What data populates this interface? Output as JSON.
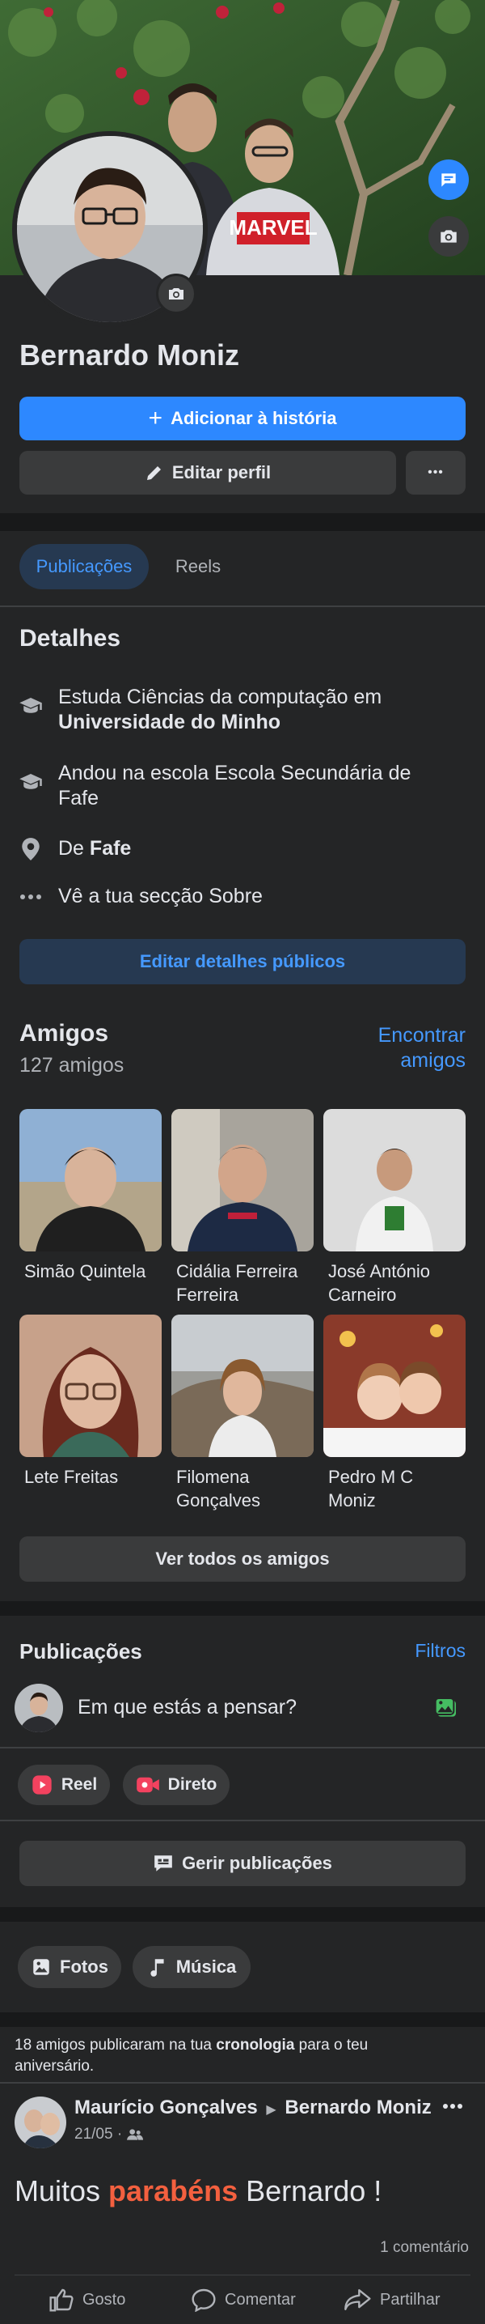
{
  "profile": {
    "name": "Bernardo Moniz",
    "cover_shirt_text": "MARVEL",
    "add_story_label": "Adicionar à história",
    "edit_profile_label": "Editar perfil",
    "more_label": "•••"
  },
  "tabs": [
    {
      "label": "Publicações",
      "active": true
    },
    {
      "label": "Reels",
      "active": false
    }
  ],
  "details": {
    "title": "Detalhes",
    "study_prefix": "Estuda Ciências da computação em",
    "study_place": "Universidade do Minho",
    "school_line1": "Andou na escola Escola Secundária de",
    "school_line2": "Fafe",
    "from_prefix": "De",
    "from_place": "Fafe",
    "about": "Vê a tua secção Sobre",
    "edit_public_label": "Editar detalhes públicos"
  },
  "friends": {
    "title": "Amigos",
    "count": "127 amigos",
    "find_line1": "Encontrar",
    "find_line2": "amigos",
    "list": [
      {
        "line1": "Simão Quintela",
        "line2": ""
      },
      {
        "line1": "Cidália Ferreira",
        "line2": "Ferreira"
      },
      {
        "line1": "José António",
        "line2": "Carneiro"
      },
      {
        "line1": "Lete Freitas",
        "line2": ""
      },
      {
        "line1": "Filomena",
        "line2": "Gonçalves"
      },
      {
        "line1": "Pedro M C",
        "line2": "Moniz"
      }
    ],
    "see_all_label": "Ver todos os amigos"
  },
  "posts": {
    "title": "Publicações",
    "filters_label": "Filtros",
    "composer_placeholder": "Em que estás a pensar?",
    "reel_label": "Reel",
    "live_label": "Direto",
    "manage_label": "Gerir publicações"
  },
  "media_chips": [
    {
      "label": "Fotos",
      "icon": "photos-icon"
    },
    {
      "label": "Música",
      "icon": "music-note-icon"
    }
  ],
  "birthday_notice": {
    "prefix": "18 amigos publicaram na tua",
    "bold": "cronologia",
    "suffix": "para o teu",
    "line2": "aniversário."
  },
  "post": {
    "author": "Maurício Gonçalves",
    "arrow": "▶",
    "target": "Bernardo Moniz",
    "date": "21/05 ·",
    "text_before": "Muitos",
    "text_highlight": "parabéns",
    "text_after": "Bernardo !",
    "comments": "1 comentário",
    "like_label": "Gosto",
    "comment_label": "Comentar",
    "share_label": "Partilhar"
  },
  "colors": {
    "accent": "#2d88ff",
    "link": "#4599ff",
    "surface": "#242526",
    "button": "#3a3b3c",
    "divider": "#18191a",
    "highlight": "#f3603f"
  }
}
